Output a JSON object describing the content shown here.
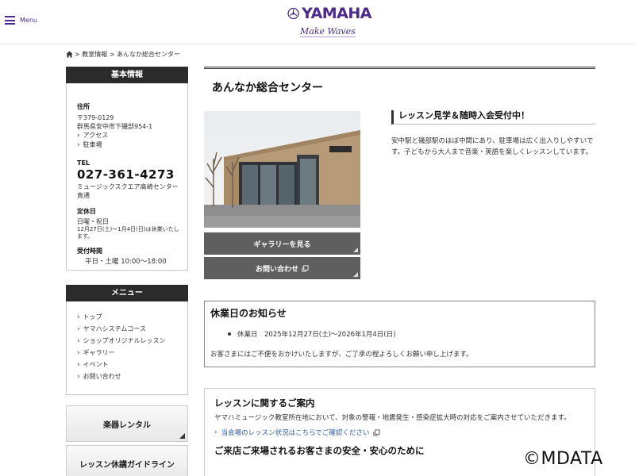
{
  "header": {
    "menu_label": "Menu",
    "logo_text": "YAMAHA",
    "logo_tagline": "Make Waves",
    "brand_color": "#4b2a8a"
  },
  "breadcrumb": "> 教室情報 > あんなか総合センター",
  "sidebar": {
    "basic": {
      "heading": "基本情報",
      "address_label": "住所",
      "postal": "〒379-0129",
      "address": "群馬県安中市下磯部954-1",
      "links": [
        "アクセス",
        "駐車場"
      ],
      "tel_label": "TEL",
      "tel": "027-361-4273",
      "tel_note": "ミュージックスクエア高崎センター直通",
      "closed_label": "定休日",
      "closed_days": "日曜・祝日",
      "closed_note": "12月27日(土)〜1月4日(日)は休業いたします。",
      "hours_label": "受付時間",
      "hours": "平日・土曜 10:00〜18:00"
    },
    "menu": {
      "heading": "メニュー",
      "items": [
        "トップ",
        "ヤマハシステムコース",
        "ショップオリジナルレッスン",
        "ギャラリー",
        "イベント",
        "お問い合わせ"
      ]
    },
    "buttons": [
      "楽器レンタル",
      "レッスン休講ガイドライン"
    ]
  },
  "main": {
    "title": "あんなか総合センター",
    "gallery_button": "ギャラリーを見る",
    "contact_button": "お問い合わせ",
    "sub_heading": "レッスン見学＆随時入会受付中！",
    "lead": "安中駅と磯部駅のほぼ中間にあり、駐車場は広く出入りしやすいです。子どもから大人まで音楽・英語を楽しくレッスンしています。",
    "notice": {
      "title": "休業日のお知らせ",
      "item": "休業日　2025年12月27日(土)〜2026年1月4日(日)",
      "body": "お客さまにはご不便をおかけいたしますが、ご了承の程よろしくお願い申し上げます。"
    },
    "guide": {
      "title": "レッスンに関するご案内",
      "body": "ヤマハミュージック教室所在地において、対象の警報・地震発生・感染症拡大時の対応をご案内させていただきます。",
      "link": "当会場のレッスン状況はこちらでご確認ください",
      "title2": "ご来店ご来場されるお客さまの安全・安心のために"
    }
  },
  "watermark": "©MDATA"
}
